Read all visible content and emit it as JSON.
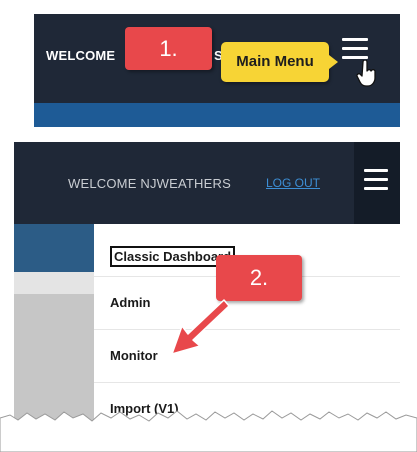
{
  "top_panel": {
    "welcome_text": "WELCOME",
    "partial_letter": "S",
    "callout_number": "1.",
    "tooltip_text": "Main Menu"
  },
  "bottom_panel": {
    "welcome_text": "WELCOME NJWEATHERS",
    "logout_label": "LOG OUT",
    "callout_number": "2.",
    "menu_items": [
      {
        "label": "Classic Dashboard"
      },
      {
        "label": "Admin"
      },
      {
        "label": "Monitor"
      },
      {
        "label": "Import (V1)"
      }
    ]
  },
  "icons": {
    "menu": "hamburger-menu-icon",
    "cursor": "hand-pointer-icon",
    "arrow": "red-arrow-icon"
  },
  "colors": {
    "header_bg": "#1f2837",
    "accent_blue": "#1e5b96",
    "callout_red": "#e8484b",
    "tooltip_yellow": "#f7d435",
    "link_blue": "#3d8fd6"
  }
}
